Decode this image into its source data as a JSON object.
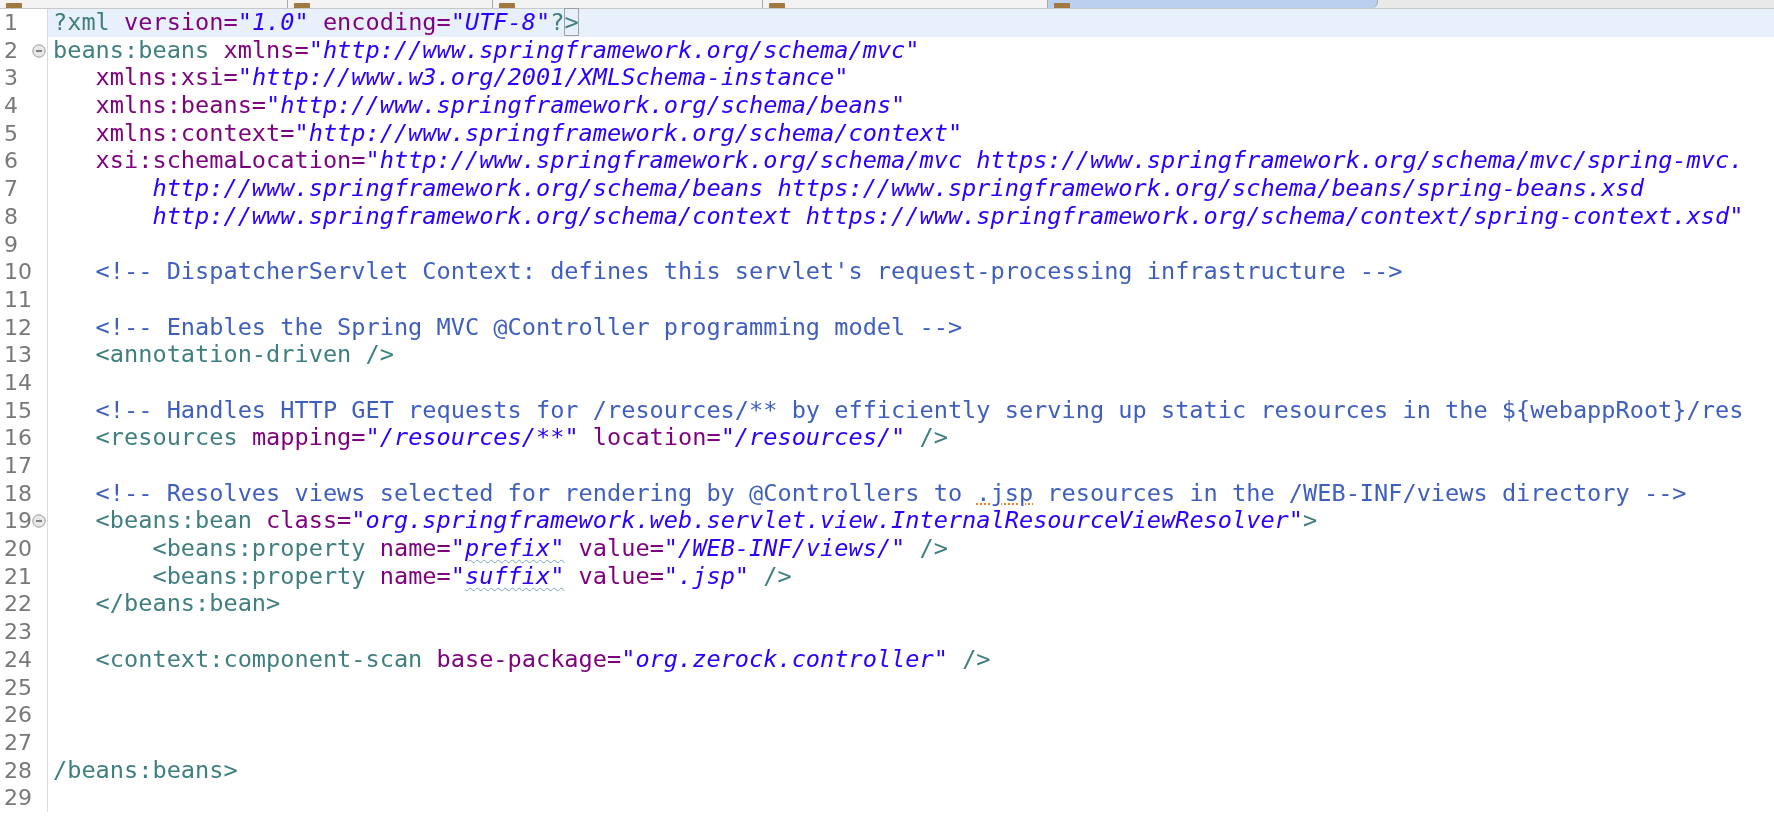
{
  "tabs": [
    {
      "selected": false
    },
    {
      "selected": false
    },
    {
      "selected": false
    },
    {
      "selected": false
    },
    {
      "selected": true
    }
  ],
  "lines": [
    {
      "number": "1",
      "current": true,
      "foldable": false,
      "tokens": [
        {
          "kind": "tag",
          "text": "?xml"
        },
        {
          "kind": "attr",
          "text": " version="
        },
        {
          "kind": "value",
          "text": "\"1.0\""
        },
        {
          "kind": "attr",
          "text": " encoding="
        },
        {
          "kind": "value",
          "text": "\"UTF-8\""
        },
        {
          "kind": "tag",
          "text": "?"
        },
        {
          "kind": "tag",
          "text": ">",
          "bracket_match": true
        }
      ]
    },
    {
      "number": "2",
      "current": false,
      "foldable": true,
      "tokens": [
        {
          "kind": "tag",
          "text": "beans:beans"
        },
        {
          "kind": "attr",
          "text": " xmlns="
        },
        {
          "kind": "value",
          "text": "\"http://www.springframework.org/schema/mvc\""
        }
      ]
    },
    {
      "number": "3",
      "current": false,
      "foldable": false,
      "tokens": [
        {
          "kind": "attr",
          "text": "   xmlns:xsi="
        },
        {
          "kind": "value",
          "text": "\"http://www.w3.org/2001/XMLSchema-instance\""
        }
      ]
    },
    {
      "number": "4",
      "current": false,
      "foldable": false,
      "tokens": [
        {
          "kind": "attr",
          "text": "   xmlns:beans="
        },
        {
          "kind": "value",
          "text": "\"http://www.springframework.org/schema/beans\""
        }
      ]
    },
    {
      "number": "5",
      "current": false,
      "foldable": false,
      "tokens": [
        {
          "kind": "attr",
          "text": "   xmlns:context="
        },
        {
          "kind": "value",
          "text": "\"http://www.springframework.org/schema/context\""
        }
      ]
    },
    {
      "number": "6",
      "current": false,
      "foldable": false,
      "tokens": [
        {
          "kind": "attr",
          "text": "   xsi:schemaLocation="
        },
        {
          "kind": "value",
          "text": "\"http://www.springframework.org/schema/mvc https://www.springframework.org/schema/mvc/spring-mvc."
        }
      ]
    },
    {
      "number": "7",
      "current": false,
      "foldable": false,
      "tokens": [
        {
          "kind": "value",
          "text": "       http://www.springframework.org/schema/beans https://www.springframework.org/schema/beans/spring-beans.xsd"
        }
      ]
    },
    {
      "number": "8",
      "current": false,
      "foldable": false,
      "tokens": [
        {
          "kind": "value",
          "text": "       http://www.springframework.org/schema/context https://www.springframework.org/schema/context/spring-context.xsd\""
        }
      ]
    },
    {
      "number": "9",
      "current": false,
      "foldable": false
    },
    {
      "number": "10",
      "current": false,
      "foldable": false,
      "tokens": [
        {
          "kind": "comment",
          "text": "   <!-- DispatcherServlet Context: defines this servlet's request-processing infrastructure -->"
        }
      ]
    },
    {
      "number": "11",
      "current": false,
      "foldable": false
    },
    {
      "number": "12",
      "current": false,
      "foldable": false,
      "tokens": [
        {
          "kind": "comment",
          "text": "   <!-- Enables the Spring MVC @Controller programming model -->"
        }
      ]
    },
    {
      "number": "13",
      "current": false,
      "foldable": false,
      "tokens": [
        {
          "kind": "tag",
          "text": "   <annotation-driven />"
        }
      ]
    },
    {
      "number": "14",
      "current": false,
      "foldable": false
    },
    {
      "number": "15",
      "current": false,
      "foldable": false,
      "tokens": [
        {
          "kind": "comment",
          "text": "   <!-- Handles HTTP GET requests for /resources/** by efficiently serving up static resources in the ${webappRoot}/res"
        }
      ]
    },
    {
      "number": "16",
      "current": false,
      "foldable": false,
      "tokens": [
        {
          "kind": "tag",
          "text": "   <resources"
        },
        {
          "kind": "attr",
          "text": " mapping="
        },
        {
          "kind": "value",
          "text": "\"/resources/**\""
        },
        {
          "kind": "attr",
          "text": " location="
        },
        {
          "kind": "value",
          "text": "\"/resources/\""
        },
        {
          "kind": "tag",
          "text": " />"
        }
      ]
    },
    {
      "number": "17",
      "current": false,
      "foldable": false
    },
    {
      "number": "18",
      "current": false,
      "foldable": false,
      "tokens": [
        {
          "kind": "comment",
          "text": "   <!-- Resolves views selected for rendering by @Controllers to "
        },
        {
          "kind": "comment",
          "text": ".jsp",
          "warning": true
        },
        {
          "kind": "comment",
          "text": " resources in the /WEB-INF/views directory -->"
        }
      ]
    },
    {
      "number": "19",
      "current": false,
      "foldable": true,
      "tokens": [
        {
          "kind": "tag",
          "text": "   <beans:bean"
        },
        {
          "kind": "attr",
          "text": " class="
        },
        {
          "kind": "value",
          "text": "\"org.springframework.web.servlet.view.InternalResourceViewResolver\""
        },
        {
          "kind": "tag",
          "text": ">"
        }
      ]
    },
    {
      "number": "20",
      "current": false,
      "foldable": false,
      "tokens": [
        {
          "kind": "tag",
          "text": "       <beans:property"
        },
        {
          "kind": "attr",
          "text": " name="
        },
        {
          "kind": "value",
          "text": "\""
        },
        {
          "kind": "value",
          "text": "prefix\"",
          "misspelled": true
        },
        {
          "kind": "attr",
          "text": " value="
        },
        {
          "kind": "value",
          "text": "\"/WEB-INF/views/\""
        },
        {
          "kind": "tag",
          "text": " />"
        }
      ]
    },
    {
      "number": "21",
      "current": false,
      "foldable": false,
      "tokens": [
        {
          "kind": "tag",
          "text": "       <beans:property"
        },
        {
          "kind": "attr",
          "text": " name="
        },
        {
          "kind": "value",
          "text": "\""
        },
        {
          "kind": "value",
          "text": "suffix\"",
          "misspelled": true
        },
        {
          "kind": "attr",
          "text": " value="
        },
        {
          "kind": "value",
          "text": "\".jsp\""
        },
        {
          "kind": "tag",
          "text": " />"
        }
      ]
    },
    {
      "number": "22",
      "current": false,
      "foldable": false,
      "tokens": [
        {
          "kind": "tag",
          "text": "   </beans:bean>"
        }
      ]
    },
    {
      "number": "23",
      "current": false,
      "foldable": false
    },
    {
      "number": "24",
      "current": false,
      "foldable": false,
      "tokens": [
        {
          "kind": "tag",
          "text": "   <context:component-scan"
        },
        {
          "kind": "attr",
          "text": " base-package="
        },
        {
          "kind": "value",
          "text": "\"org.zerock.controller\""
        },
        {
          "kind": "tag",
          "text": " />"
        }
      ]
    },
    {
      "number": "25",
      "current": false,
      "foldable": false
    },
    {
      "number": "26",
      "current": false,
      "foldable": false
    },
    {
      "number": "27",
      "current": false,
      "foldable": false
    },
    {
      "number": "28",
      "current": false,
      "foldable": false,
      "tokens": [
        {
          "kind": "tag",
          "text": "/beans:beans>"
        }
      ]
    },
    {
      "number": "29",
      "current": false,
      "foldable": false
    }
  ]
}
